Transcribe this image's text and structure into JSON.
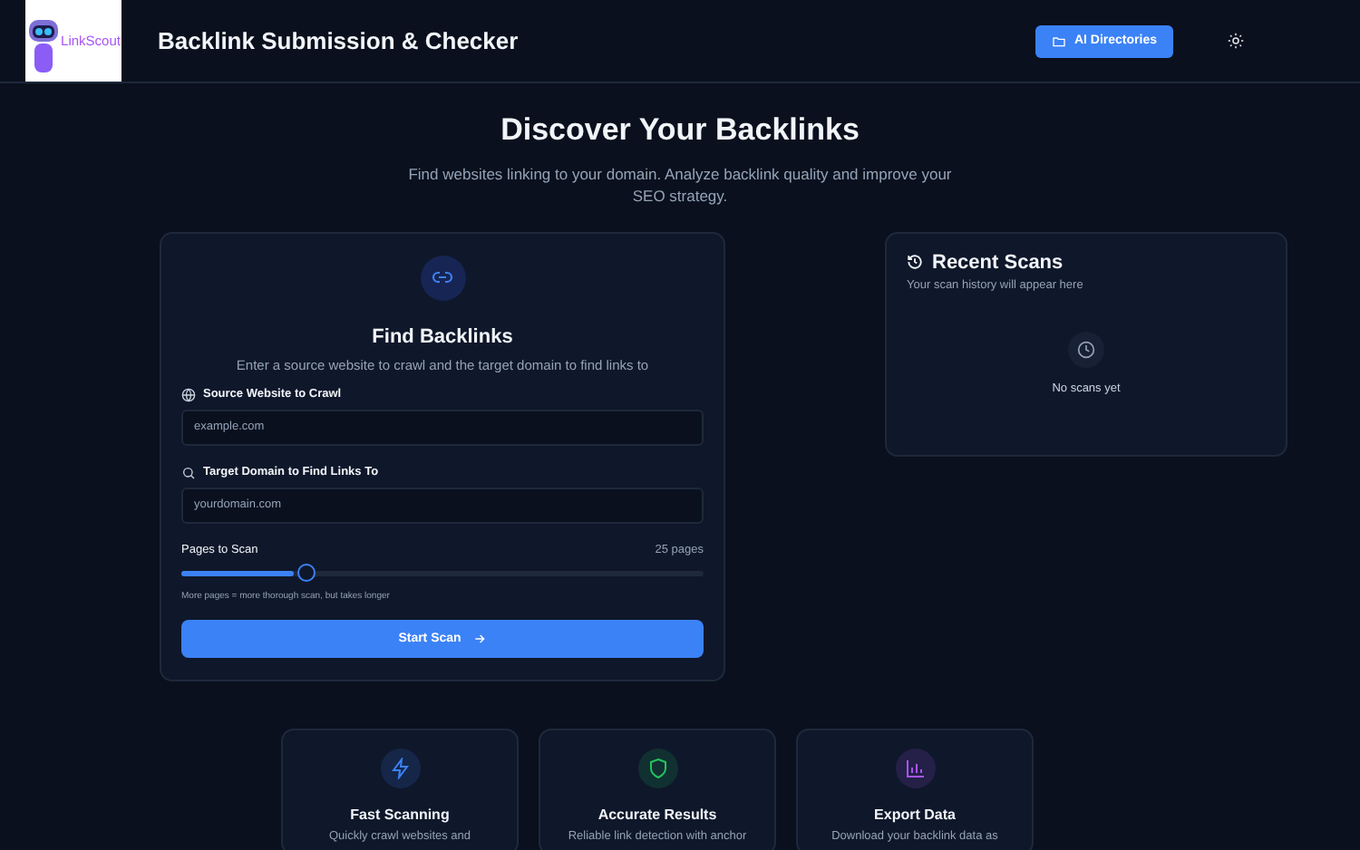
{
  "header": {
    "logo_text": "LinkScout",
    "title": "Backlink Submission & Checker",
    "button": "AI Directories"
  },
  "hero": {
    "title": "Discover Your Backlinks",
    "subtitle": "Find websites linking to your domain. Analyze backlink quality and improve your SEO strategy."
  },
  "find_card": {
    "title": "Find Backlinks",
    "description": "Enter a source website to crawl and the target domain to find links to",
    "fields": [
      {
        "kind": "globe",
        "label": "Source Website to Crawl",
        "placeholder": "example.com"
      },
      {
        "kind": "search",
        "label": "Target Domain to Find Links To",
        "placeholder": "yourdomain.com"
      }
    ],
    "slider": {
      "label": "Pages to Scan",
      "reading": "25 pages",
      "level": 0.22,
      "hint": "More pages = more thorough scan, but takes longer"
    },
    "button": "Start Scan"
  },
  "recent_scans": {
    "title": "Recent Scans",
    "subtitle": "Your scan history will appear here",
    "empty": "No scans yet"
  },
  "features": [
    {
      "kind": "bolt",
      "color": "#3b82f6",
      "title": "Fast Scanning",
      "description": "Quickly crawl websites and"
    },
    {
      "kind": "shield",
      "color": "#22c55e",
      "title": "Accurate Results",
      "description": "Reliable link detection with anchor"
    },
    {
      "kind": "chart",
      "color": "#a855f7",
      "title": "Export Data",
      "description": "Download your backlink data as"
    }
  ]
}
